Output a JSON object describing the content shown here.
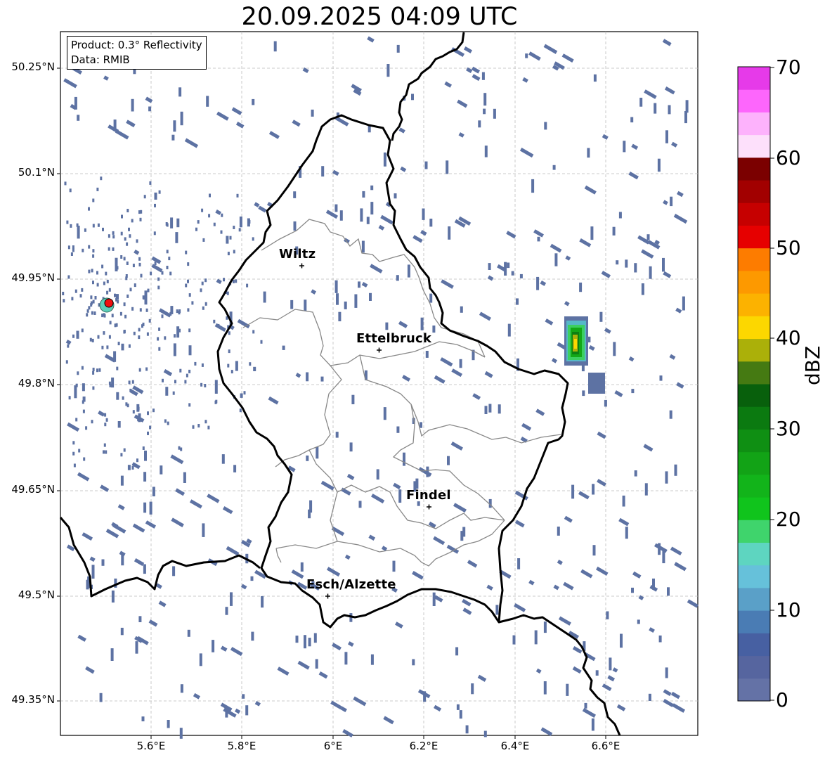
{
  "title": "20.09.2025 04:09 UTC",
  "info_box": {
    "product": "Product: 0.3° Reflectivity",
    "data": "Data: RMIB"
  },
  "lat_labels": [
    "50.25°N",
    "50.1°N",
    "49.95°N",
    "49.8°N",
    "49.65°N",
    "49.5°N",
    "49.35°N"
  ],
  "lon_labels": [
    "5.6°E",
    "5.8°E",
    "6°E",
    "6.2°E",
    "6.4°E",
    "6.6°E"
  ],
  "cities": [
    {
      "name": "Wiltz"
    },
    {
      "name": "Ettelbruck"
    },
    {
      "name": "Findel"
    },
    {
      "name": "Esch/Alzette"
    }
  ],
  "colorbar": {
    "label": "dBZ",
    "ticks": [
      "70",
      "60",
      "50",
      "40",
      "30",
      "20",
      "10",
      "0"
    ],
    "range": [
      0,
      70
    ],
    "colors": [
      "#6472a6",
      "#56659f",
      "#4760a2",
      "#4a7cb4",
      "#5aa0c8",
      "#66c1da",
      "#5ed5c0",
      "#3fd46c",
      "#10c41c",
      "#12b41a",
      "#12a316",
      "#0f8f13",
      "#0b7a10",
      "#08600c",
      "#457a12",
      "#abb009",
      "#fcd700",
      "#fcb200",
      "#fd9900",
      "#fd7c00",
      "#e60000",
      "#c60000",
      "#a20000",
      "#7b0000",
      "#fde0fb",
      "#fdb2fc",
      "#fd66fc",
      "#e63ae9"
    ]
  }
}
